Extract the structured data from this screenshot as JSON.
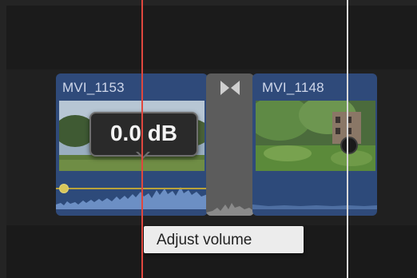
{
  "timeline": {
    "clips": [
      {
        "name": "MVI_1153"
      },
      {
        "name": "MVI_1148"
      }
    ],
    "volume_value": "0.0 dB",
    "tooltip": "Adjust volume"
  },
  "colors": {
    "clip_blue": "#2f4a7a",
    "transition_gray": "#5c5c5c",
    "playhead_red": "#e0473e",
    "skimmer_white": "#d9d9d9",
    "volume_line": "#b9a23a",
    "tooltip_bg": "#ececec"
  },
  "icons": {
    "transition": "transition-bowtie-icon",
    "keyframe": "volume-keyframe-icon"
  }
}
